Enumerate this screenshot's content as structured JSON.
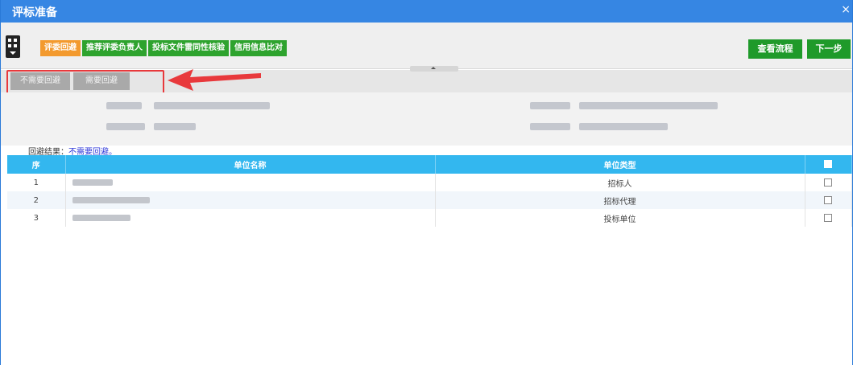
{
  "window": {
    "title": "评标准备",
    "close_glyph": "×"
  },
  "toolbar": {
    "tabs": [
      {
        "label": "评委回避",
        "active": true
      },
      {
        "label": "推荐评委负责人",
        "active": false
      },
      {
        "label": "投标文件雷同性核验",
        "active": false
      },
      {
        "label": "信用信息比对",
        "active": false
      }
    ],
    "view_flow_label": "查看流程",
    "next_label": "下一步"
  },
  "subbar": {
    "no_avoid_label": "不需要回避",
    "need_avoid_label": "需要回避"
  },
  "result": {
    "label": "回避结果：",
    "value": "不需要回避。"
  },
  "table": {
    "headers": {
      "seq": "序",
      "name": "单位名称",
      "type": "单位类型"
    },
    "rows": [
      {
        "seq": "1",
        "type": "招标人"
      },
      {
        "seq": "2",
        "type": "招标代理"
      },
      {
        "seq": "3",
        "type": "投标单位"
      }
    ]
  },
  "colors": {
    "title_bar": "#3686e3",
    "tab_active": "#f39a2e",
    "tab_normal": "#2ea32e",
    "button_green": "#1f9a2a",
    "table_header": "#33b7ef",
    "annotation_red": "#e8393c"
  }
}
